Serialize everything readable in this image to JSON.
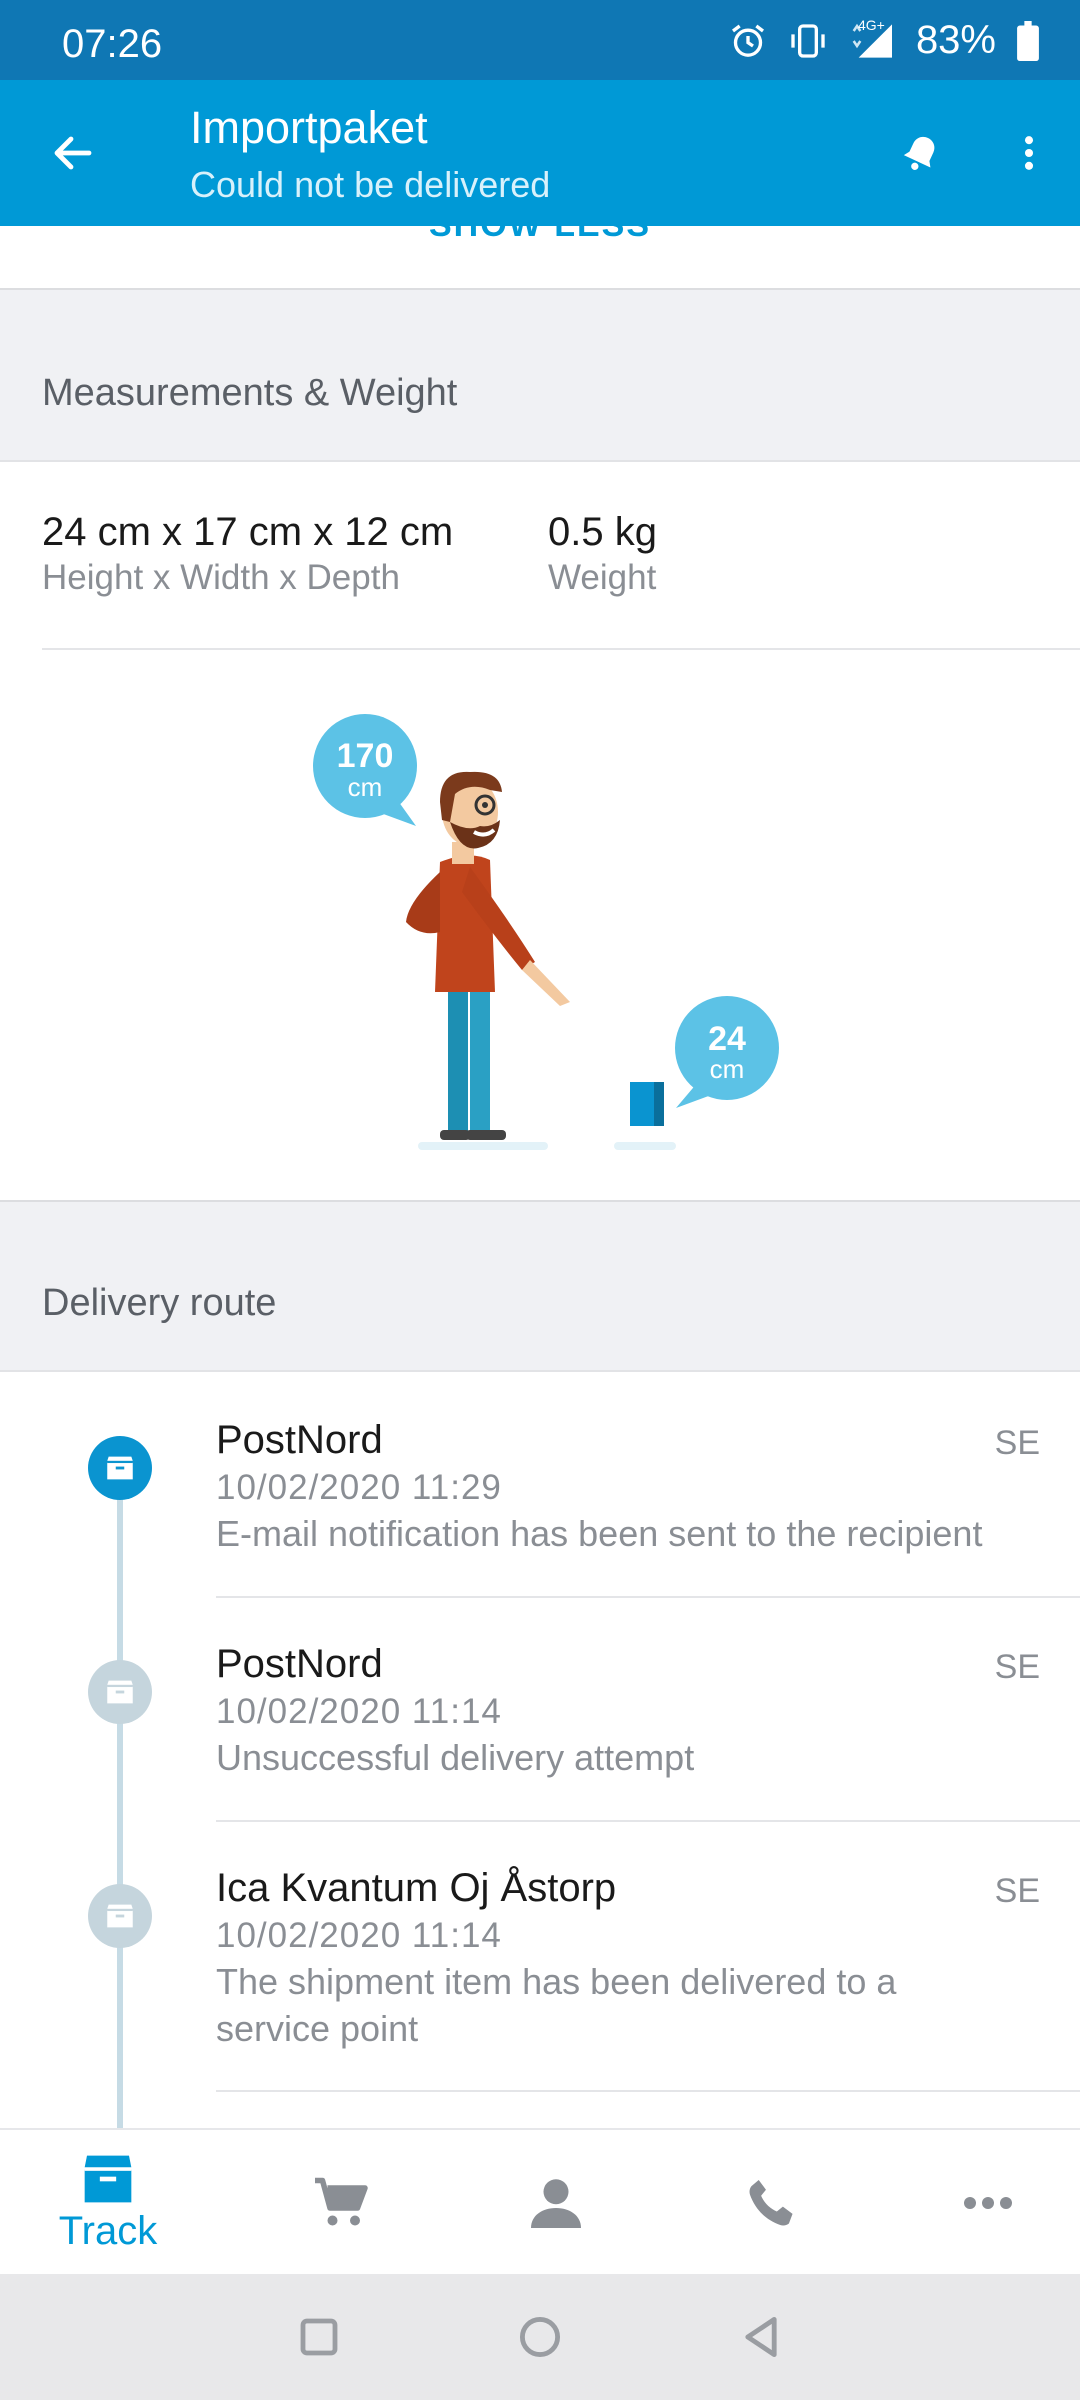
{
  "status_bar": {
    "time": "07:26",
    "network": "4G+",
    "battery": "83%"
  },
  "app_bar": {
    "title": "Importpaket",
    "subtitle": "Could not be delivered"
  },
  "show_less_label": "SHOW LESS",
  "measurements": {
    "header": "Measurements & Weight",
    "dimensions_value": "24 cm x 17 cm x 12 cm",
    "dimensions_label": "Height x Width x Depth",
    "weight_value": "0.5 kg",
    "weight_label": "Weight",
    "person_height_value": "170",
    "person_height_unit": "cm",
    "package_height_value": "24",
    "package_height_unit": "cm"
  },
  "delivery_route": {
    "header": "Delivery route",
    "events": [
      {
        "carrier": "PostNord",
        "country": "SE",
        "date": "10/02/2020 11:29",
        "description": "E-mail notification has been sent to the recipient",
        "active": true
      },
      {
        "carrier": "PostNord",
        "country": "SE",
        "date": "10/02/2020 11:14",
        "description": "Unsuccessful delivery attempt",
        "active": false
      },
      {
        "carrier": "Ica Kvantum Oj Åstorp",
        "country": "SE",
        "date": "10/02/2020 11:14",
        "description": "The shipment item has been delivered to a service point",
        "active": false
      }
    ]
  },
  "bottom_nav": {
    "items": [
      {
        "label": "Track",
        "icon": "package-icon",
        "selected": true
      },
      {
        "label": "",
        "icon": "cart-icon",
        "selected": false
      },
      {
        "label": "",
        "icon": "person-icon",
        "selected": false
      },
      {
        "label": "",
        "icon": "phone-icon",
        "selected": false
      },
      {
        "label": "",
        "icon": "more-horizontal-icon",
        "selected": false
      }
    ]
  },
  "colors": {
    "status_bar": "#0f77b4",
    "app_bar": "#0099d6",
    "accent": "#0099d6",
    "bubble": "#5cc2e6"
  }
}
